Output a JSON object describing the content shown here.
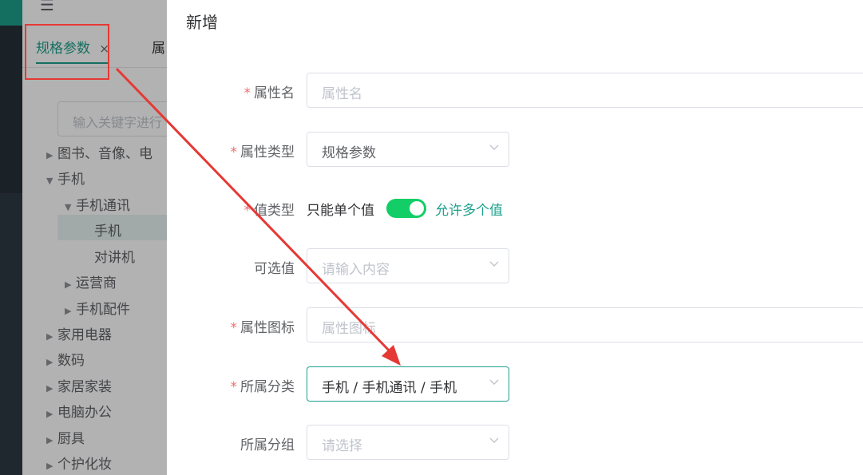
{
  "background": {
    "tabs": [
      {
        "label": "规格参数",
        "close": "×",
        "active": true
      },
      {
        "label": "属"
      }
    ],
    "search_placeholder": "输入关键字进行",
    "tree": [
      {
        "label": "图书、音像、电",
        "collapsed": true
      },
      {
        "label": "手机",
        "expanded": true
      },
      {
        "label": "手机通讯",
        "expanded": true
      },
      {
        "label": "手机",
        "selected": true
      },
      {
        "label": "对讲机"
      },
      {
        "label": "运营商",
        "collapsed": true
      },
      {
        "label": "手机配件",
        "collapsed": true
      },
      {
        "label": "家用电器",
        "collapsed": true
      },
      {
        "label": "数码",
        "collapsed": true
      },
      {
        "label": "家居家装",
        "collapsed": true
      },
      {
        "label": "电脑办公",
        "collapsed": true
      },
      {
        "label": "厨具",
        "collapsed": true
      },
      {
        "label": "个护化妆",
        "collapsed": true
      }
    ]
  },
  "dialog": {
    "title": "新增",
    "required_mark": "*",
    "attr_name": {
      "label": "属性名",
      "placeholder": "属性名"
    },
    "attr_type": {
      "label": "属性类型",
      "value": "规格参数"
    },
    "value_type": {
      "label": "值类型",
      "off_text": "只能单个值",
      "on_text": "允许多个值",
      "on": true
    },
    "selectable": {
      "label": "可选值",
      "placeholder": "请输入内容"
    },
    "attr_icon": {
      "label": "属性图标",
      "placeholder": "属性图标"
    },
    "category": {
      "label": "所属分类",
      "value": "手机 / 手机通讯 / 手机"
    },
    "group": {
      "label": "所属分组",
      "placeholder": "请选择"
    }
  },
  "colors": {
    "accent": "#1ea08c",
    "switch_on": "#13ce66",
    "required": "#f56c6c",
    "annotation": "#e53935"
  }
}
